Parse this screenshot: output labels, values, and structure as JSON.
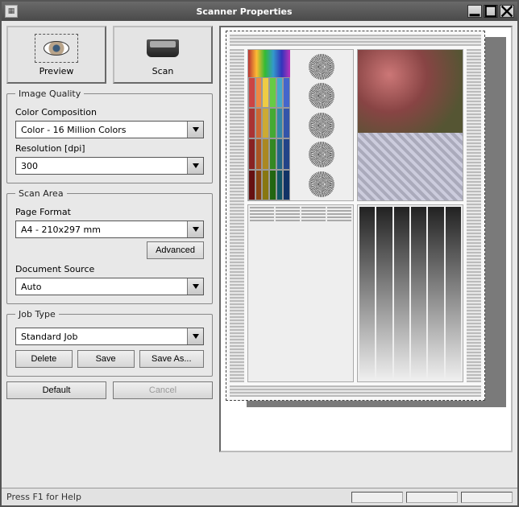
{
  "window": {
    "title": "Scanner Properties"
  },
  "buttons": {
    "preview": "Preview",
    "scan": "Scan"
  },
  "imageQuality": {
    "legend": "Image Quality",
    "colorCompositionLabel": "Color Composition",
    "colorCompositionValue": "Color - 16 Million Colors",
    "resolutionLabel": "Resolution [dpi]",
    "resolutionValue": "300"
  },
  "scanArea": {
    "legend": "Scan Area",
    "pageFormatLabel": "Page Format",
    "pageFormatValue": "A4 - 210x297 mm",
    "advancedLabel": "Advanced",
    "documentSourceLabel": "Document Source",
    "documentSourceValue": "Auto"
  },
  "jobType": {
    "legend": "Job Type",
    "value": "Standard Job",
    "delete": "Delete",
    "save": "Save",
    "saveAs": "Save As..."
  },
  "footerButtons": {
    "default": "Default",
    "cancel": "Cancel"
  },
  "status": {
    "help": "Press F1 for Help"
  }
}
